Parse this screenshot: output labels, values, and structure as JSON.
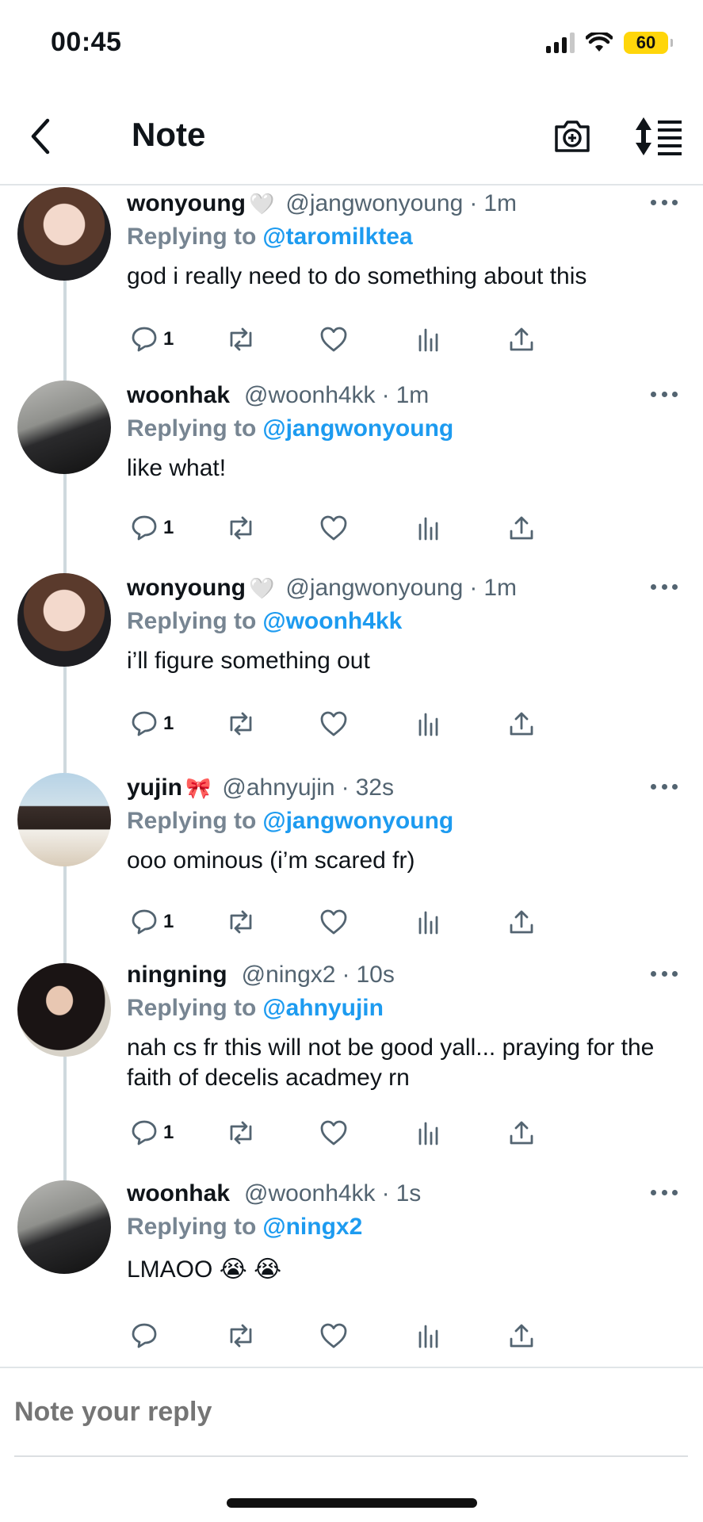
{
  "status_bar": {
    "time": "00:45",
    "battery": "60"
  },
  "header": {
    "title": "Note",
    "icons": [
      "back-arrow-icon",
      "camera-plus-icon",
      "sort-icon"
    ]
  },
  "tweets": [
    {
      "name": "wonyoung",
      "emoji": "🤍",
      "handle": "@jangwonyoung",
      "time": "1m",
      "reply_label": "Replying to",
      "reply_to": "@taromilktea",
      "text": "god i really need to do something about this",
      "reply_count": "1"
    },
    {
      "name": "woonhak",
      "emoji": "",
      "handle": "@woonh4kk",
      "time": "1m",
      "reply_label": "Replying to",
      "reply_to": "@jangwonyoung",
      "text": "like what!",
      "reply_count": "1"
    },
    {
      "name": "wonyoung",
      "emoji": "🤍",
      "handle": "@jangwonyoung",
      "time": "1m",
      "reply_label": "Replying to",
      "reply_to": "@woonh4kk",
      "text": "i’ll figure something out",
      "reply_count": "1"
    },
    {
      "name": "yujin",
      "emoji": "🎀",
      "handle": "@ahnyujin",
      "time": "32s",
      "reply_label": "Replying to",
      "reply_to": "@jangwonyoung",
      "text": "ooo ominous (i’m scared fr)",
      "reply_count": "1"
    },
    {
      "name": "ningning",
      "emoji": "",
      "handle": "@ningx2",
      "time": "10s",
      "reply_label": "Replying to",
      "reply_to": "@ahnyujin",
      "text": "nah cs fr this will not be good yall... praying for the faith of decelis acadmey rn",
      "reply_count": "1"
    },
    {
      "name": "woonhak",
      "emoji": "",
      "handle": "@woonh4kk",
      "time": "1s",
      "reply_label": "Replying to",
      "reply_to": "@ningx2",
      "text": "LMAOO 😭 😭",
      "reply_count": ""
    }
  ],
  "composer": {
    "placeholder": "Note your reply"
  },
  "colors": {
    "link": "#1d9bf0",
    "muted": "#536471",
    "divider": "#e1e5e8",
    "battery": "#ffd60a"
  }
}
